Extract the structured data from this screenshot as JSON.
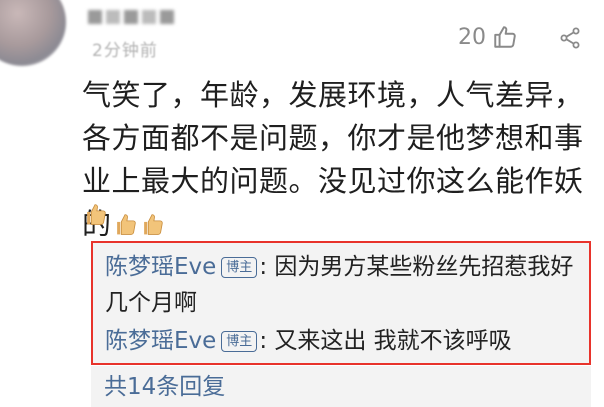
{
  "header": {
    "time_label": "2分钟前",
    "like_count": "20",
    "like_icon": "thumbs-up-outline-icon",
    "share_icon": "share-icon"
  },
  "comment": {
    "text": "气笑了，年龄，发展环境，人气差异，各方面都不是问题，你才是他梦想和事业上最大的问题。没见过你这么能作妖的",
    "emoji": "thumbs-up-emoji"
  },
  "replies": [
    {
      "user": "陈梦瑶Eve",
      "badge": "博主",
      "separator": ": ",
      "text": "因为男方某些粉丝先招惹我好几个月啊"
    },
    {
      "user": "陈梦瑶Eve",
      "badge": "博主",
      "separator": ": ",
      "text": "又来这出 我就不该呼吸"
    }
  ],
  "more_replies_label": "共14条回复",
  "colors": {
    "link_blue": "#4a6c97",
    "highlight_red": "#e8332b",
    "reply_bg": "#f3f3f3"
  }
}
